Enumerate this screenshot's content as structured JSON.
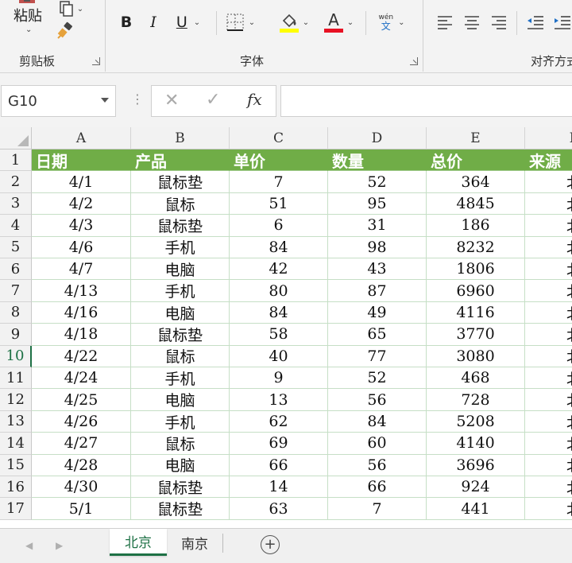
{
  "ribbon": {
    "paste_label": "粘贴",
    "groups": {
      "clipboard": "剪贴板",
      "font": "字体",
      "alignment": "对齐方式"
    },
    "font_buttons": {
      "bold": "B",
      "italic": "I",
      "underline": "U"
    },
    "phonetic": {
      "top": "wén",
      "bottom": "文"
    },
    "colors": {
      "highlight": "#ffff00",
      "font_color": "#e81123",
      "accent": "#1e7145",
      "table_header": "#70ad47"
    }
  },
  "formula_bar": {
    "name_box": "G10",
    "fx_label": "fx",
    "formula": ""
  },
  "grid": {
    "columns": [
      "A",
      "B",
      "C",
      "D",
      "E",
      "F"
    ],
    "row_numbers": [
      "1",
      "2",
      "3",
      "4",
      "5",
      "6",
      "7",
      "8",
      "9",
      "10",
      "11",
      "12",
      "13",
      "14",
      "15",
      "16",
      "17"
    ],
    "active_row": "10",
    "header": [
      "日期",
      "产品",
      "单价",
      "数量",
      "总价",
      "来源"
    ],
    "rows": [
      [
        "4/1",
        "鼠标垫",
        "7",
        "52",
        "364",
        "北"
      ],
      [
        "4/2",
        "鼠标",
        "51",
        "95",
        "4845",
        "北"
      ],
      [
        "4/3",
        "鼠标垫",
        "6",
        "31",
        "186",
        "北"
      ],
      [
        "4/6",
        "手机",
        "84",
        "98",
        "8232",
        "北"
      ],
      [
        "4/7",
        "电脑",
        "42",
        "43",
        "1806",
        "北"
      ],
      [
        "4/13",
        "手机",
        "80",
        "87",
        "6960",
        "北"
      ],
      [
        "4/16",
        "电脑",
        "84",
        "49",
        "4116",
        "北"
      ],
      [
        "4/18",
        "鼠标垫",
        "58",
        "65",
        "3770",
        "北"
      ],
      [
        "4/22",
        "鼠标",
        "40",
        "77",
        "3080",
        "北"
      ],
      [
        "4/24",
        "手机",
        "9",
        "52",
        "468",
        "北"
      ],
      [
        "4/25",
        "电脑",
        "13",
        "56",
        "728",
        "北"
      ],
      [
        "4/26",
        "手机",
        "62",
        "84",
        "5208",
        "北"
      ],
      [
        "4/27",
        "鼠标",
        "69",
        "60",
        "4140",
        "北"
      ],
      [
        "4/28",
        "电脑",
        "66",
        "56",
        "3696",
        "北"
      ],
      [
        "4/30",
        "鼠标垫",
        "14",
        "66",
        "924",
        "北"
      ],
      [
        "5/1",
        "鼠标垫",
        "63",
        "7",
        "441",
        "北"
      ]
    ]
  },
  "sheets": [
    "北京",
    "南京"
  ],
  "active_sheet": "北京"
}
